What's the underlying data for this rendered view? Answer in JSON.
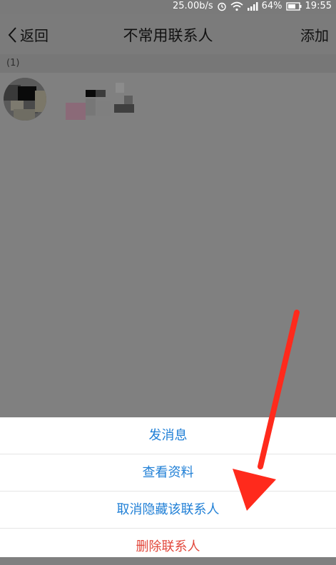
{
  "status": {
    "speed": "25.00b/s",
    "battery_pct": "64%",
    "time": "19:55"
  },
  "navbar": {
    "back_label": "返回",
    "title": "不常用联系人",
    "add_label": "添加"
  },
  "list": {
    "group_count": "(1)"
  },
  "sheet": {
    "items": [
      "发消息",
      "查看资料",
      "取消隐藏该联系人",
      "删除联系人"
    ]
  },
  "colors": {
    "sheet_link": "#1f7fd6",
    "sheet_danger": "#e2473b",
    "annotation_arrow": "#ff2a1c"
  }
}
